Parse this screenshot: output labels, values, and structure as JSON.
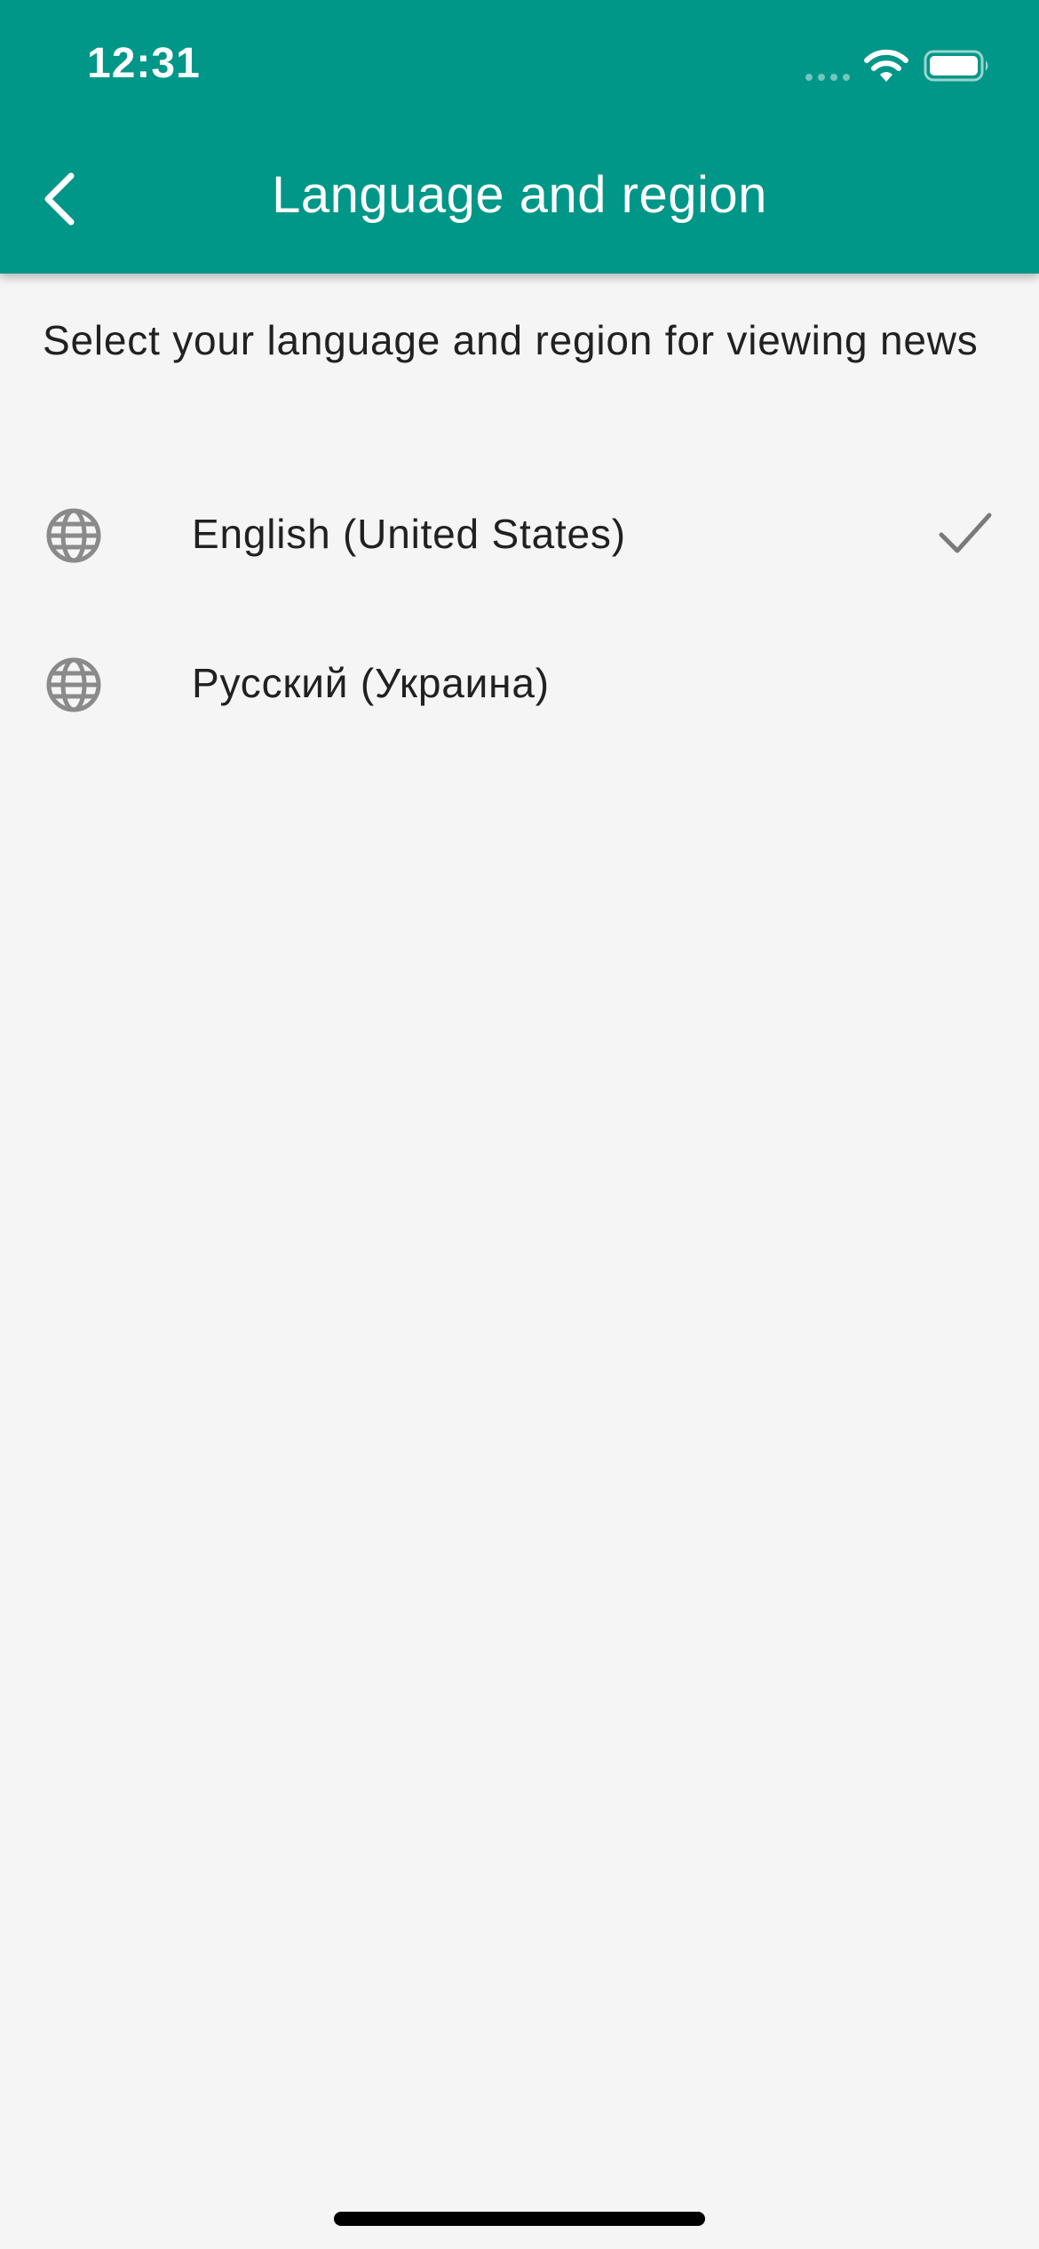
{
  "status_bar": {
    "time": "12:31"
  },
  "app_bar": {
    "title": "Language and region",
    "back_icon": "chevron-left-icon",
    "background_color": "#009688"
  },
  "content": {
    "subtitle": "Select your language and region for viewing news",
    "languages": [
      {
        "label": "English (United States)",
        "icon": "globe-icon",
        "selected": true
      },
      {
        "label": "Русский (Украина)",
        "icon": "globe-icon",
        "selected": false
      }
    ]
  }
}
